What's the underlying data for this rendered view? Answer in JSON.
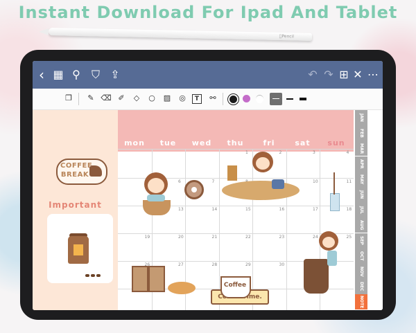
{
  "headline": "Instant Download For Ipad And Tablet",
  "pencil_brand": "Pencil",
  "navbar": {
    "back_icon": "‹",
    "grid_icon": "▦",
    "search_icon": "⚲",
    "bookmark_icon": "⛉",
    "share_icon": "⇪",
    "undo_icon": "↶",
    "redo_icon": "↷",
    "add_page_icon": "⊞",
    "close_icon": "✕",
    "more_icon": "⋯"
  },
  "toolbar": {
    "icons": [
      "page-layout-icon",
      "pen-icon",
      "eraser-icon",
      "highlighter-icon",
      "shapes-icon",
      "lasso-icon",
      "image-icon",
      "camera-icon",
      "text-icon",
      "link-icon"
    ],
    "icon_glyphs": [
      "❐",
      "✎",
      "⌫",
      "✐",
      "◇",
      "○",
      "▨",
      "◎",
      "T",
      "⚯"
    ],
    "colors": [
      "#1c1c1c",
      "#c46cc9",
      "#ffffff"
    ],
    "stroke_widths": [
      "thin",
      "medium",
      "thick"
    ]
  },
  "left_panel": {
    "logo_text": "COFFEE BREAK",
    "important_label": "Important"
  },
  "calendar": {
    "days": [
      "mon",
      "tue",
      "wed",
      "thu",
      "fri",
      "sat",
      "sun"
    ],
    "row_numbers": [
      [
        "",
        "",
        "",
        "1",
        "2",
        "3",
        "4"
      ],
      [
        "5",
        "6",
        "7",
        "8",
        "9",
        "10",
        "11"
      ],
      [
        "12",
        "13",
        "14",
        "15",
        "16",
        "17",
        "18"
      ],
      [
        "19",
        "20",
        "21",
        "22",
        "23",
        "24",
        "25"
      ],
      [
        "26",
        "27",
        "28",
        "29",
        "30",
        "31",
        ""
      ]
    ]
  },
  "months": [
    "JAN",
    "FEB",
    "MAR",
    "APR",
    "MAY",
    "JUN",
    "JUL",
    "AUG",
    "SEP",
    "OCT",
    "NOV",
    "DEC",
    "NOTE"
  ],
  "stickers": {
    "coffee_time": "Coffee Time.",
    "coffee_mug": "Coffee"
  },
  "colors": {
    "nav": "#566b95",
    "header": "#f4b9b6",
    "left_panel": "#fde7d7",
    "month_tab": "#a9a9a9",
    "note_tab": "#f2703b",
    "headline": "#7fcbb0"
  }
}
